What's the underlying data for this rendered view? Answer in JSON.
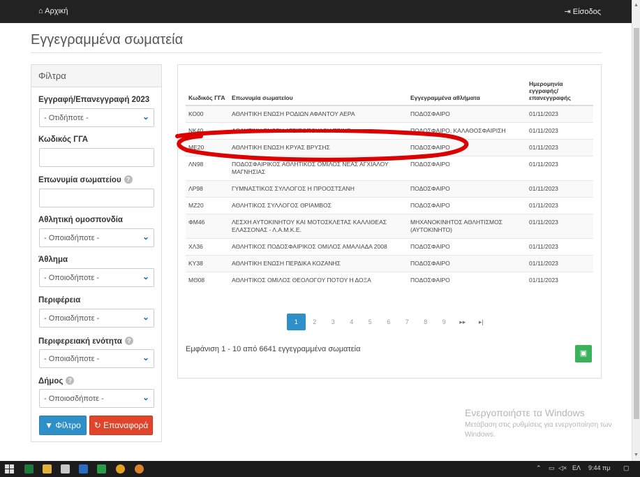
{
  "nav": {
    "home_label": "Αρχική",
    "login_label": "Είσοδος"
  },
  "page": {
    "title": "Εγγεγραμμένα σωματεία"
  },
  "filters": {
    "heading": "Φίλτρα",
    "registration_label": "Εγγραφή/Επανεγγραφή 2023",
    "registration_value": "- Οτιδήποτε -",
    "code_label": "Κωδικός ΓΓΑ",
    "code_value": "",
    "name_label": "Επωνυμία σωματείου",
    "name_value": "",
    "federation_label": "Αθλητική ομοσπονδία",
    "federation_value": "- Οποιαδήποτε -",
    "sport_label": "Άθλημα",
    "sport_value": "- Οποιοδήποτε -",
    "region_label": "Περιφέρεια",
    "region_value": "- Οποιαδήποτε -",
    "unit_label": "Περιφερειακή ενότητα",
    "unit_value": "- Οποιαδήποτε -",
    "municipality_label": "Δήμος",
    "municipality_value": "- Οποιοσδήποτε -",
    "filter_button": "Φίλτρο",
    "reset_button": "Επαναφορά"
  },
  "table": {
    "headers": [
      "Κωδικός ΓΓΑ",
      "Επωνυμία σωματείου",
      "Εγγεγραμμένα αθλήματα",
      "Ημερομηνία εγγραφής/ επανεγγραφής"
    ],
    "rows": [
      [
        "ΚΟ00",
        "ΑΘΛΗΤΙΚΗ ΕΝΩΣΗ ΡΟΔΙΩΝ ΑΦΑΝΤΟΥ ΑΕΡΑ",
        "ΠΟΔΟΣΦΑΙΡΟ",
        "01/11/2023"
      ],
      [
        "ΝΚ40",
        "ΑΘΛΗΤΙΚΗ ΕΝΩΣΗ ΑΤΣΙΠΟΠΟΥΛΟΥ-ΠΡΙΝΕ",
        "ΠΟΔΟΣΦΑΙΡΟ, ΚΑΛΑΘΟΣΦΑΙΡΙΣΗ",
        "01/11/2023"
      ],
      [
        "ΜΕ20",
        "ΑΘΛΗΤΙΚΗ ΕΝΩΣΗ ΚΡΥΑΣ ΒΡΥΣΗΣ",
        "ΠΟΔΟΣΦΑΙΡΟ",
        "01/11/2023"
      ],
      [
        "ΛΝ98",
        "ΠΟΔΟΣΦΑΙΡΙΚΟΣ ΑΘΛΗΤΙΚΟΣ ΟΜΙΛΟΣ ΝΕΑΣ ΑΓΧΙΑΛΟΥ ΜΑΓΝΗΣΙΑΣ",
        "ΠΟΔΟΣΦΑΙΡΟ",
        "01/11/2023"
      ],
      [
        "ΛΡ98",
        "ΓΥΜΝΑΣΤΙΚΟΣ ΣΥΛΛΟΓΟΣ Η ΠΡΟΟΣΤΣΑΝΗ",
        "ΠΟΔΟΣΦΑΙΡΟ",
        "01/11/2023"
      ],
      [
        "ΜΖ20",
        "ΑΘΛΗΤΙΚΟΣ ΣΥΛΛΟΓΟΣ ΘΡΙΑΜΒΟΣ",
        "ΠΟΔΟΣΦΑΙΡΟ",
        "01/11/2023"
      ],
      [
        "ΦΜ46",
        "ΛΕΣΧΗ ΑΥΤΟΚΙΝΗΤΟΥ ΚΑΙ ΜΟΤΟΣΚΛΕΤΑΣ ΚΑΛΛΙΘΕΑΣ ΕΛΑΣΣΟΝΑΣ - Λ.Α.Μ.Κ.Ε.",
        "ΜΗΧΑΝΟΚΙΝΗΤΟΣ ΑΘΛΗΤΙΣΜΟΣ (ΑΥΤΟΚΙΝΗΤΟ)",
        "01/11/2023"
      ],
      [
        "ΧΛ36",
        "ΑΘΛΗΤΙΚΟΣ ΠΟΔΟΣΦΑΙΡΙΚΟΣ ΟΜΙΛΟΣ ΑΜΑΛΙΑΔΑ 2008",
        "ΠΟΔΟΣΦΑΙΡΟ",
        "01/11/2023"
      ],
      [
        "ΚΥ38",
        "ΑΘΛΗΤΙΚΗ ΕΝΩΣΗ ΠΕΡΔΙΚΑ ΚΟΖΑΝΗΣ",
        "ΠΟΔΟΣΦΑΙΡΟ",
        "01/11/2023"
      ],
      [
        "ΜΘ08",
        "ΑΘΛΗΤΙΚΟΣ ΟΜΙΛΟΣ ΘΕΟΛΟΓΟΥ ΠΟΤΟΥ Η ΔΟΞΑ",
        "ΠΟΔΟΣΦΑΙΡΟ",
        "01/11/2023"
      ]
    ]
  },
  "pager": {
    "pages": [
      "1",
      "2",
      "3",
      "4",
      "5",
      "6",
      "7",
      "8",
      "9"
    ],
    "next": "▸▸",
    "last": "▸|",
    "active": "1"
  },
  "summary": "Εμφάνιση 1 - 10 από 6641 εγγεγραμμένα σωματεία",
  "watermark": {
    "line1": "Ενεργοποιήστε τα Windows",
    "line2": "Μετάβαση στις ρυθμίσεις για ενεργοποίηση των Windows."
  },
  "taskbar": {
    "lang": "ΕΛ",
    "time": "9:44 πμ"
  },
  "colors": {
    "accent": "#2e8fc9",
    "danger": "#e0442a",
    "success": "#3ab15a",
    "annotation": "#dd0000",
    "nav": "#222222"
  }
}
